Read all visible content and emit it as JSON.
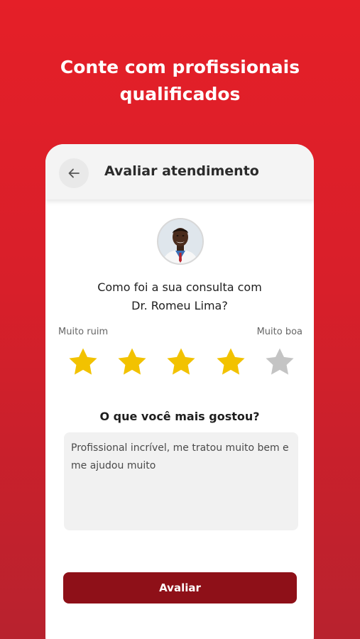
{
  "headline": {
    "line1": "Conte com profissionais",
    "line2": "qualificados"
  },
  "appbar": {
    "back_icon": "arrow-left-icon",
    "title": "Avaliar atendimento"
  },
  "doctor": {
    "avatar": "doctor-photo"
  },
  "question": {
    "line1": "Como foi a sua consulta com",
    "line2": "Dr. Romeu Lima?"
  },
  "rating": {
    "min_label": "Muito ruim",
    "max_label": "Muito boa",
    "value": 4,
    "max": 5,
    "filled_color": "#f2c200",
    "empty_color": "#c4c4c4"
  },
  "feedback": {
    "title": "O que você mais gostou?",
    "text": "Profissional incrível, me tratou muito bem e me ajudou muito"
  },
  "submit": {
    "label": "Avaliar"
  },
  "colors": {
    "brand_red": "#e51f28",
    "button_dark_red": "#8e1018"
  }
}
